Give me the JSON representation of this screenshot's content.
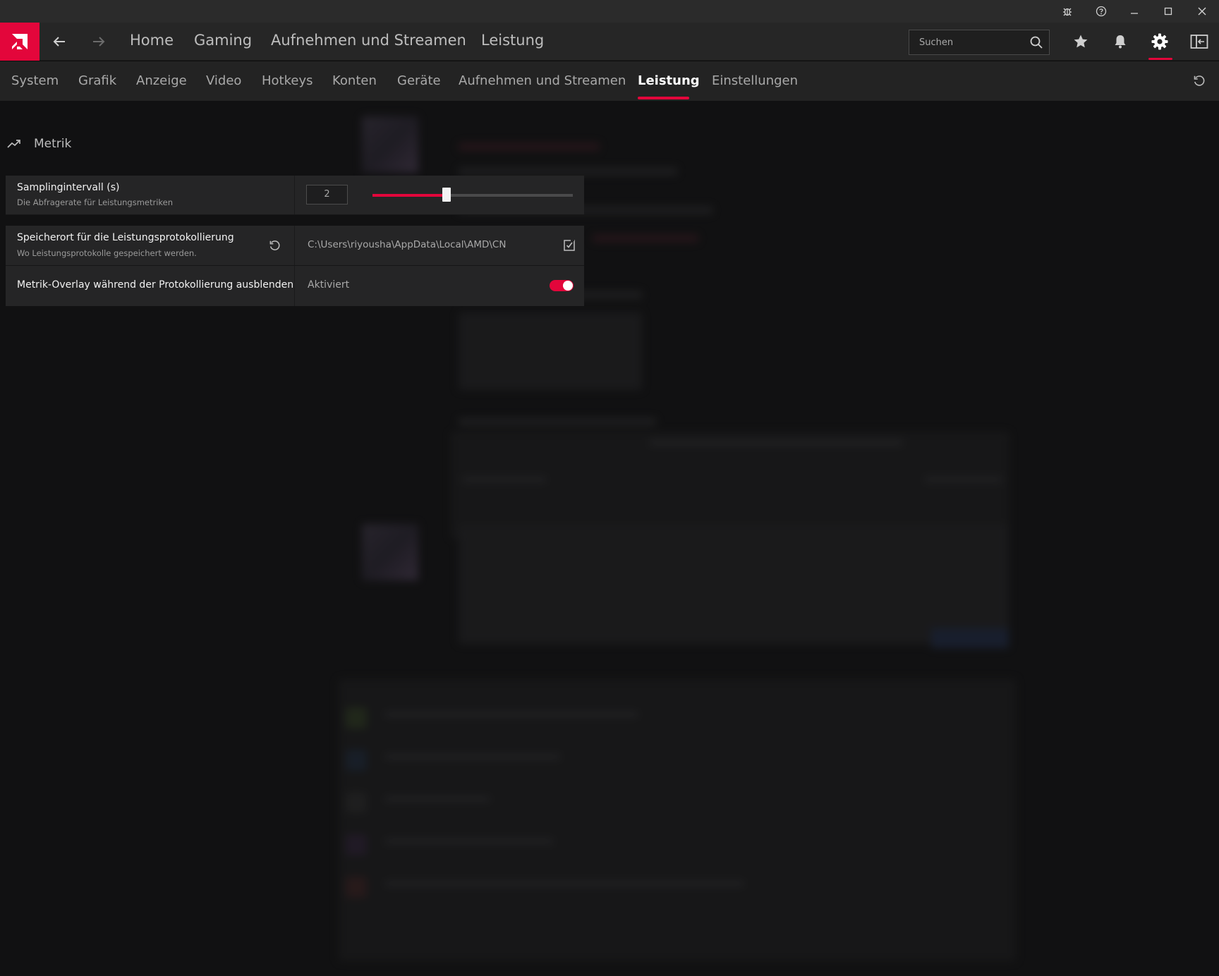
{
  "titlebar": {
    "icons": [
      "bug-icon",
      "help-icon",
      "minimize-icon",
      "maximize-icon",
      "close-icon"
    ]
  },
  "mainnav": {
    "links": [
      "Home",
      "Gaming",
      "Aufnehmen und Streamen",
      "Leistung"
    ],
    "search_placeholder": "Suchen",
    "icons": [
      "favorites-star-icon",
      "notifications-bell-icon",
      "settings-gear-icon",
      "sidebar-toggle-icon"
    ]
  },
  "subnav": {
    "tabs": [
      "System",
      "Grafik",
      "Anzeige",
      "Video",
      "Hotkeys",
      "Konten",
      "Geräte",
      "Aufnehmen und Streamen",
      "Leistung",
      "Einstellungen"
    ],
    "active_tab": "Leistung"
  },
  "section": {
    "title": "Metrik"
  },
  "settings": {
    "sampling": {
      "title": "Samplingintervall (s)",
      "description": "Die Abfragerate für Leistungsmetriken",
      "value": "2",
      "slider_fraction": 0.37
    },
    "log_location": {
      "title": "Speicherort für die Leistungsprotokollierung",
      "description": "Wo Leistungsprotokolle gespeichert werden.",
      "path": "C:\\Users\\riyousha\\AppData\\Local\\AMD\\CN"
    },
    "overlay": {
      "title": "Metrik-Overlay während der Protokollierung ausblenden",
      "status": "Aktiviert",
      "enabled": true
    }
  },
  "colors": {
    "accent": "#e3063b",
    "background": "#0f0f10",
    "panel": "#252526"
  }
}
